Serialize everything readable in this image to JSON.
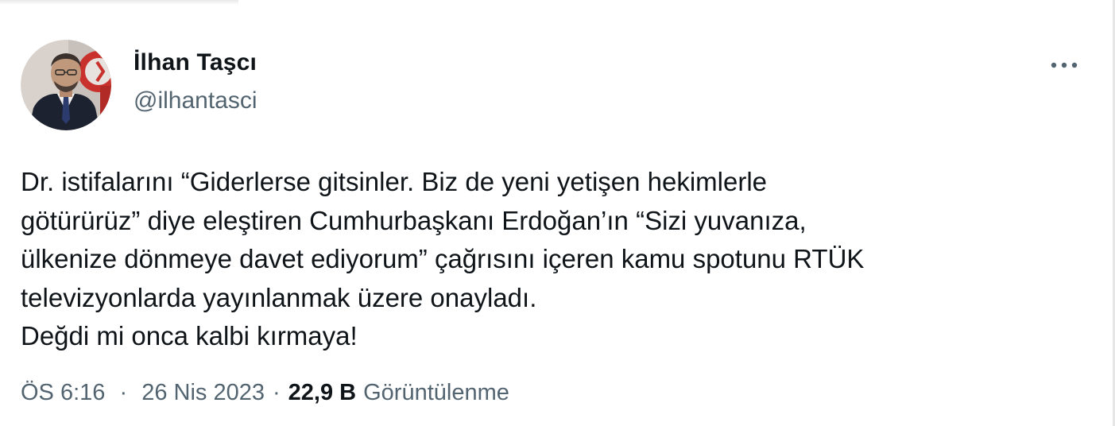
{
  "author": {
    "display_name": "İlhan Taşcı",
    "handle": "@ilhantasci",
    "avatar_icon": "profile-photo"
  },
  "more_icon": "more-horizontal-icon",
  "tweet": {
    "lines": [
      "Dr. istifalarını “Giderlerse gitsinler. Biz de yeni yetişen hekimlerle",
      "götürürüz” diye eleştiren Cumhurbaşkanı Erdoğan’ın “Sizi yuvanıza,",
      "ülkenize dönmeye davet ediyorum” çağrısını içeren kamu spotunu RTÜK",
      "televizyonlarda yayınlanmak üzere onayladı.",
      "Değdi mi onca kalbi kırmaya!"
    ]
  },
  "meta": {
    "time": "ÖS 6:16",
    "separator": "·",
    "date": "26 Nis 2023",
    "views_count": "22,9 B",
    "views_label": "Görüntülenme"
  },
  "colors": {
    "text_primary": "#0f1419",
    "text_secondary": "#536471",
    "background": "#ffffff"
  }
}
